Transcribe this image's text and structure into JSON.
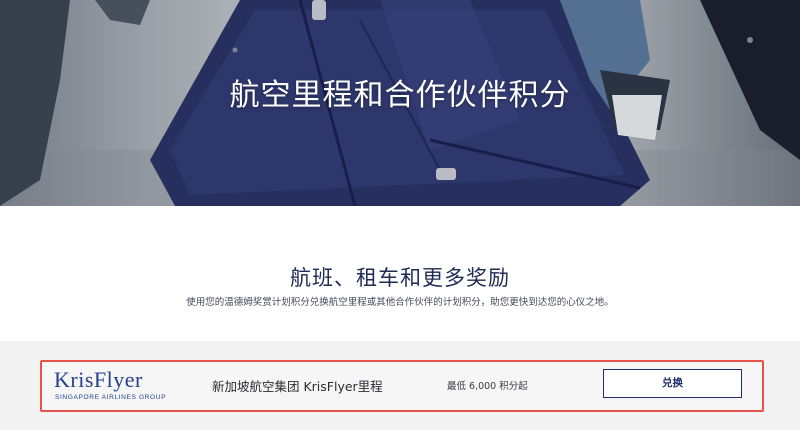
{
  "hero": {
    "title": "航空里程和合作伙伴积分"
  },
  "section": {
    "title": "航班、租车和更多奖励",
    "subtitle": "使用您的温德姆奖赏计划积分兑换航空里程或其他合作伙伴的计划积分，助您更快到达您的心仪之地。"
  },
  "offer": {
    "logo_word": "KrisFlyer",
    "logo_sub": "SINGAPORE AIRLINES GROUP",
    "name": "新加坡航空集团 KrisFlyer里程",
    "min_points": "最低 6,000 积分起",
    "button_label": "兑换"
  },
  "colors": {
    "brand_navy": "#1f2f6e",
    "logo_blue": "#23418c",
    "highlight_border": "#e5534b",
    "band_bg": "#f3f3f4"
  }
}
